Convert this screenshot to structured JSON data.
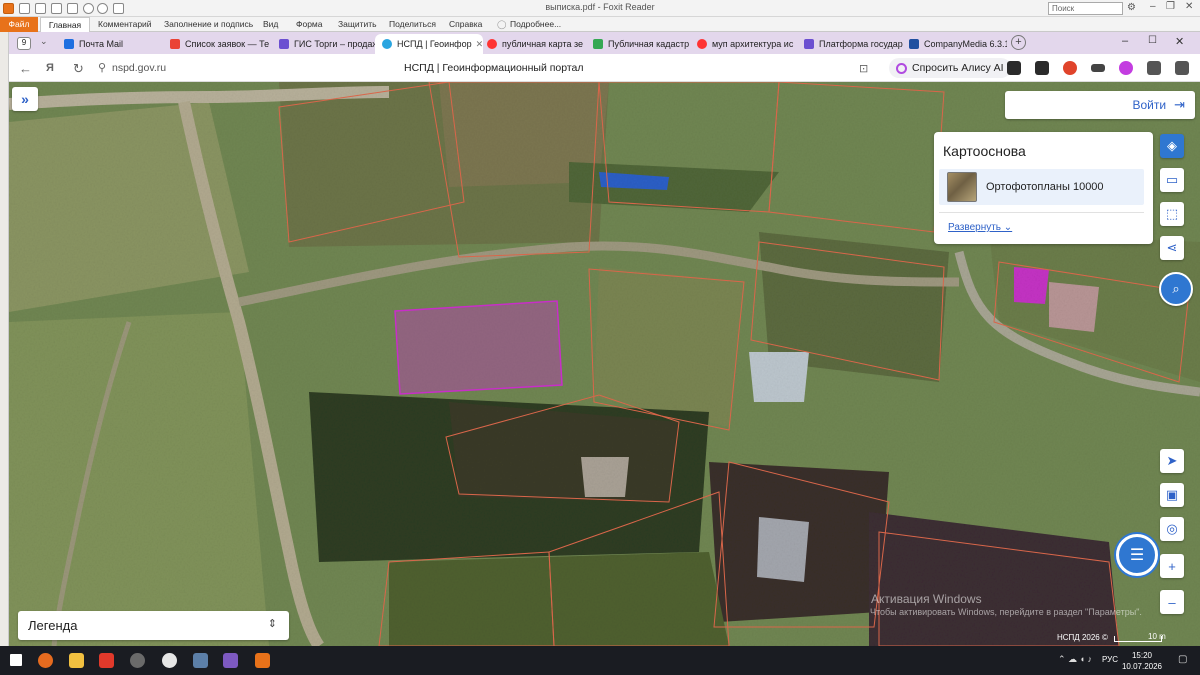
{
  "foxit": {
    "window_title": "выписка.pdf - Foxit Reader",
    "search_placeholder": "Поиск",
    "file_tab": "Файл",
    "home_tab": "Главная",
    "menu": [
      "Комментарий",
      "Заполнение и подпись",
      "Вид",
      "Форма",
      "Защитить",
      "Поделиться",
      "Справка",
      "Подробнее..."
    ]
  },
  "browser": {
    "tab_counter": "9",
    "tabs": [
      {
        "label": "Почта Mail",
        "color": "#1f6fe0"
      },
      {
        "label": "Список заявок — Те",
        "color": "#ea4335"
      },
      {
        "label": "ГИС Торги – продаж",
        "color": "#6b4fd1"
      },
      {
        "label": "НСПД | Геоинфор",
        "color": "#2aa5e0",
        "active": true
      },
      {
        "label": "публичная карта зе",
        "color": "#f33"
      },
      {
        "label": "Публичная кадастр",
        "color": "#34a853"
      },
      {
        "label": "муп архитектура ис",
        "color": "#f33"
      },
      {
        "label": "Платформа государ",
        "color": "#6b4fd1"
      },
      {
        "label": "CompanyMedia 6.3.1",
        "color": "#1f4fa0"
      }
    ],
    "url": "nspd.gov.ru",
    "page_title": "НСПД | Геоинформационный портал",
    "alice_label": "Спросить Алису AI"
  },
  "map": {
    "login_label": "Войти",
    "basemap_title": "Картооснова",
    "ortho_label": "Ортофотопланы 10000",
    "expand_label": "Развернуть",
    "legend_label": "Легенда",
    "copyright": "НСПД 2026 ©",
    "scale_label": "10 m",
    "watermark_title": "Активация Windows",
    "watermark_text": "Чтобы активировать Windows, перейдите в раздел \"Параметры\"."
  },
  "taskbar": {
    "lang": "РУС",
    "time": "15:20",
    "date": "10.07.2026"
  }
}
